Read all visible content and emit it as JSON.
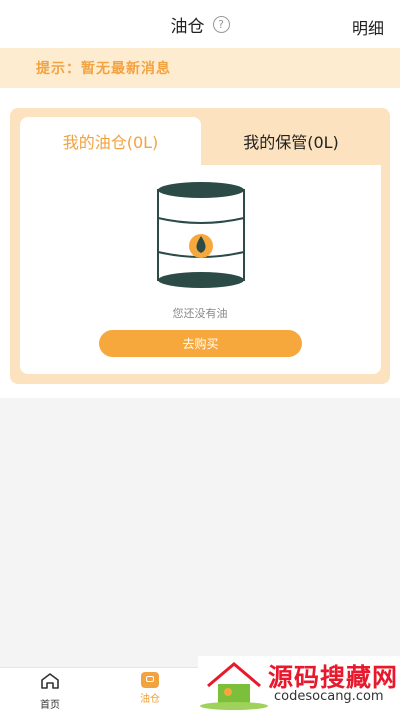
{
  "header": {
    "title": "油仓",
    "help_icon": "question-circle-icon",
    "detail_label": "明细"
  },
  "notice": {
    "text": "提示：暂无最新消息"
  },
  "tabs": [
    {
      "label": "我的油仓(0L)",
      "active": true
    },
    {
      "label": "我的保管(0L)",
      "active": false
    }
  ],
  "empty_state": {
    "icon": "oil-barrel-icon",
    "text": "您还没有油",
    "button_label": "去购买"
  },
  "bottom_nav": [
    {
      "label": "首页",
      "icon": "home-icon",
      "active": false
    },
    {
      "label": "油仓",
      "icon": "oil-tank-icon",
      "active": true
    }
  ],
  "watermark": {
    "title": "源码搜藏网",
    "url": "codesocang.com"
  },
  "colors": {
    "accent": "#f7a83d",
    "tab_active_text": "#f1a33f",
    "notice_bg": "#fdeccf",
    "card_bg": "#fde2bf"
  }
}
